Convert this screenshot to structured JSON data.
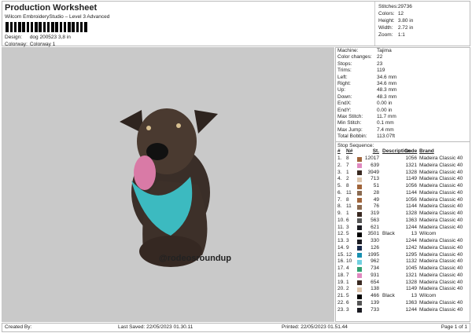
{
  "header": {
    "title": "Production Worksheet",
    "subtitle": "Wilcom EmbroideryStudio – Level 3 Advanced",
    "design_label": "Design:",
    "design_value": "dog 200523 3,8 in",
    "colorway_label": "Colorway:",
    "colorway_value": "Colorway 1"
  },
  "summary": [
    {
      "k": "Stitches:",
      "v": "29736"
    },
    {
      "k": "Colors:",
      "v": "12"
    },
    {
      "k": "Height:",
      "v": "3.80 in"
    },
    {
      "k": "Width:",
      "v": "2.72 in"
    },
    {
      "k": "Zoom:",
      "v": "1:1"
    }
  ],
  "design_text": "@rodeosroundup",
  "props": [
    {
      "k": "Machine:",
      "v": "Tajima"
    },
    {
      "k": "Color changes:",
      "v": "22"
    },
    {
      "k": "Stops:",
      "v": "23"
    },
    {
      "k": "Trims:",
      "v": "119"
    },
    {
      "k": "Left:",
      "v": "34.6 mm"
    },
    {
      "k": "Right:",
      "v": "34.6 mm"
    },
    {
      "k": "Up:",
      "v": "48.3 mm"
    },
    {
      "k": "Down:",
      "v": "48.3 mm"
    },
    {
      "k": "EndX:",
      "v": "0.00 in"
    },
    {
      "k": "EndY:",
      "v": "0.00 in"
    },
    {
      "k": "Max Stitch:",
      "v": "11.7 mm"
    },
    {
      "k": "Min Stitch:",
      "v": "0.1 mm"
    },
    {
      "k": "Max Jump:",
      "v": "7.4 mm"
    },
    {
      "k": "Total Bobbin:",
      "v": "113.07ft"
    }
  ],
  "stop_sequence": {
    "title": "Stop Sequence:",
    "headers": [
      "#",
      "N#",
      "St.",
      "Description",
      "Code",
      "Brand"
    ],
    "rows": [
      [
        "1.",
        "8",
        "12017",
        "",
        "1056",
        "Madeira Classic 40",
        "#a0643a"
      ],
      [
        "2.",
        "7",
        "639",
        "",
        "1321",
        "Madeira Classic 40",
        "#e08ac0"
      ],
      [
        "3.",
        "1",
        "3949",
        "",
        "1328",
        "Madeira Classic 40",
        "#3a2a22"
      ],
      [
        "4.",
        "2",
        "713",
        "",
        "1149",
        "Madeira Classic 40",
        "#dcc4ac"
      ],
      [
        "5.",
        "8",
        "51",
        "",
        "1056",
        "Madeira Classic 40",
        "#a0643a"
      ],
      [
        "6.",
        "11",
        "28",
        "",
        "1144",
        "Madeira Classic 40",
        "#8a6a50"
      ],
      [
        "7.",
        "8",
        "49",
        "",
        "1056",
        "Madeira Classic 40",
        "#a0643a"
      ],
      [
        "8.",
        "11",
        "76",
        "",
        "1144",
        "Madeira Classic 40",
        "#8a6a50"
      ],
      [
        "9.",
        "1",
        "319",
        "",
        "1328",
        "Madeira Classic 40",
        "#3a2a22"
      ],
      [
        "10.",
        "6",
        "563",
        "",
        "1363",
        "Madeira Classic 40",
        "#555555"
      ],
      [
        "11.",
        "3",
        "621",
        "",
        "1244",
        "Madeira Classic 40",
        "#1c1c22"
      ],
      [
        "12.",
        "5",
        "3501",
        "Black",
        "13",
        "Wilcom",
        "#000000"
      ],
      [
        "13.",
        "3",
        "330",
        "",
        "1244",
        "Madeira Classic 40",
        "#1c1c22"
      ],
      [
        "14.",
        "9",
        "126",
        "",
        "1242",
        "Madeira Classic 40",
        "#1a2a4a"
      ],
      [
        "15.",
        "12",
        "1995",
        "",
        "1295",
        "Madeira Classic 40",
        "#1890b0"
      ],
      [
        "16.",
        "10",
        "962",
        "",
        "1132",
        "Madeira Classic 40",
        "#70d0e0"
      ],
      [
        "17.",
        "4",
        "734",
        "",
        "1045",
        "Madeira Classic 40",
        "#30a070"
      ],
      [
        "18.",
        "7",
        "931",
        "",
        "1321",
        "Madeira Classic 40",
        "#e08ac0"
      ],
      [
        "19.",
        "1",
        "654",
        "",
        "1328",
        "Madeira Classic 40",
        "#3a2a22"
      ],
      [
        "20.",
        "2",
        "138",
        "",
        "1149",
        "Madeira Classic 40",
        "#dcc4ac"
      ],
      [
        "21.",
        "5",
        "466",
        "Black",
        "13",
        "Wilcom",
        "#000000"
      ],
      [
        "22.",
        "6",
        "139",
        "",
        "1363",
        "Madeira Classic 40",
        "#555555"
      ],
      [
        "23.",
        "3",
        "733",
        "",
        "1244",
        "Madeira Classic 40",
        "#1c1c22"
      ]
    ]
  },
  "footer": {
    "created": "Created By:",
    "saved": "Last Saved: 22/05/2023 01.30.11",
    "printed": "Printed: 22/05/2023 01.51.44",
    "page": "Page 1 of 1"
  }
}
